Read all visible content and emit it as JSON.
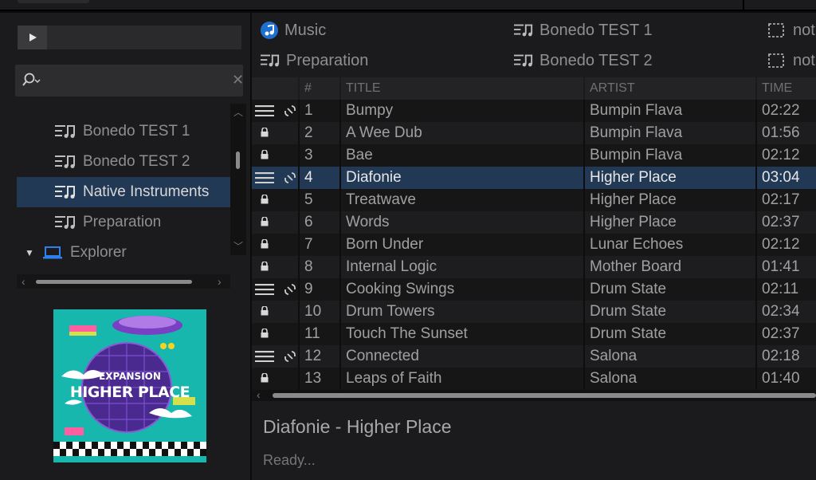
{
  "sidebar": {
    "search": {
      "value": ""
    },
    "tree": [
      {
        "label": "Bonedo TEST 1",
        "selected": false
      },
      {
        "label": "Bonedo TEST 2",
        "selected": false
      },
      {
        "label": "Native Instruments",
        "selected": true
      },
      {
        "label": "Preparation",
        "selected": false
      },
      {
        "label": "Explorer",
        "selected": false
      }
    ],
    "cover_art": {
      "line1": "EXPANSION",
      "line2": "HIGHER PLACE"
    }
  },
  "favorites": [
    {
      "label": "Music",
      "icon": "music-icon"
    },
    {
      "label": "Bonedo TEST 1",
      "icon": "playlist-icon"
    },
    {
      "label": "not",
      "icon": "empty-slot-icon"
    },
    {
      "label": "Preparation",
      "icon": "playlist-icon"
    },
    {
      "label": "Bonedo TEST 2",
      "icon": "playlist-icon"
    },
    {
      "label": "not",
      "icon": "empty-slot-icon"
    }
  ],
  "table": {
    "columns": {
      "num": "#",
      "title": "TITLE",
      "artist": "ARTIST",
      "time": "TIME"
    },
    "rows": [
      {
        "num": "1",
        "title": "Bumpy",
        "artist": "Bumpin Flava",
        "time": "02:22",
        "icons": "menu-link"
      },
      {
        "num": "2",
        "title": "A Wee Dub",
        "artist": "Bumpin Flava",
        "time": "01:56",
        "icons": "lock"
      },
      {
        "num": "3",
        "title": "Bae",
        "artist": "Bumpin Flava",
        "time": "02:12",
        "icons": "lock"
      },
      {
        "num": "4",
        "title": "Diafonie",
        "artist": "Higher Place",
        "time": "03:04",
        "icons": "menu-link",
        "selected": true
      },
      {
        "num": "5",
        "title": "Treatwave",
        "artist": "Higher Place",
        "time": "02:17",
        "icons": "lock"
      },
      {
        "num": "6",
        "title": "Words",
        "artist": "Higher Place",
        "time": "02:37",
        "icons": "lock"
      },
      {
        "num": "7",
        "title": "Born Under",
        "artist": "Lunar Echoes",
        "time": "02:12",
        "icons": "lock"
      },
      {
        "num": "8",
        "title": "Internal Logic",
        "artist": "Mother Board",
        "time": "01:41",
        "icons": "lock"
      },
      {
        "num": "9",
        "title": "Cooking Swings",
        "artist": "Drum State",
        "time": "02:11",
        "icons": "menu-link"
      },
      {
        "num": "10",
        "title": "Drum Towers",
        "artist": "Drum State",
        "time": "02:34",
        "icons": "lock"
      },
      {
        "num": "11",
        "title": "Touch The Sunset",
        "artist": "Drum State",
        "time": "02:37",
        "icons": "lock"
      },
      {
        "num": "12",
        "title": "Connected",
        "artist": "Salona",
        "time": "02:18",
        "icons": "menu-link"
      },
      {
        "num": "13",
        "title": "Leaps of Faith",
        "artist": "Salona",
        "time": "01:40",
        "icons": "lock"
      }
    ]
  },
  "now_playing": {
    "text": "Diafonie - Higher Place"
  },
  "status": {
    "text": "Ready..."
  },
  "colors": {
    "selection": "#223956",
    "accent_blue": "#1f6fd1"
  }
}
